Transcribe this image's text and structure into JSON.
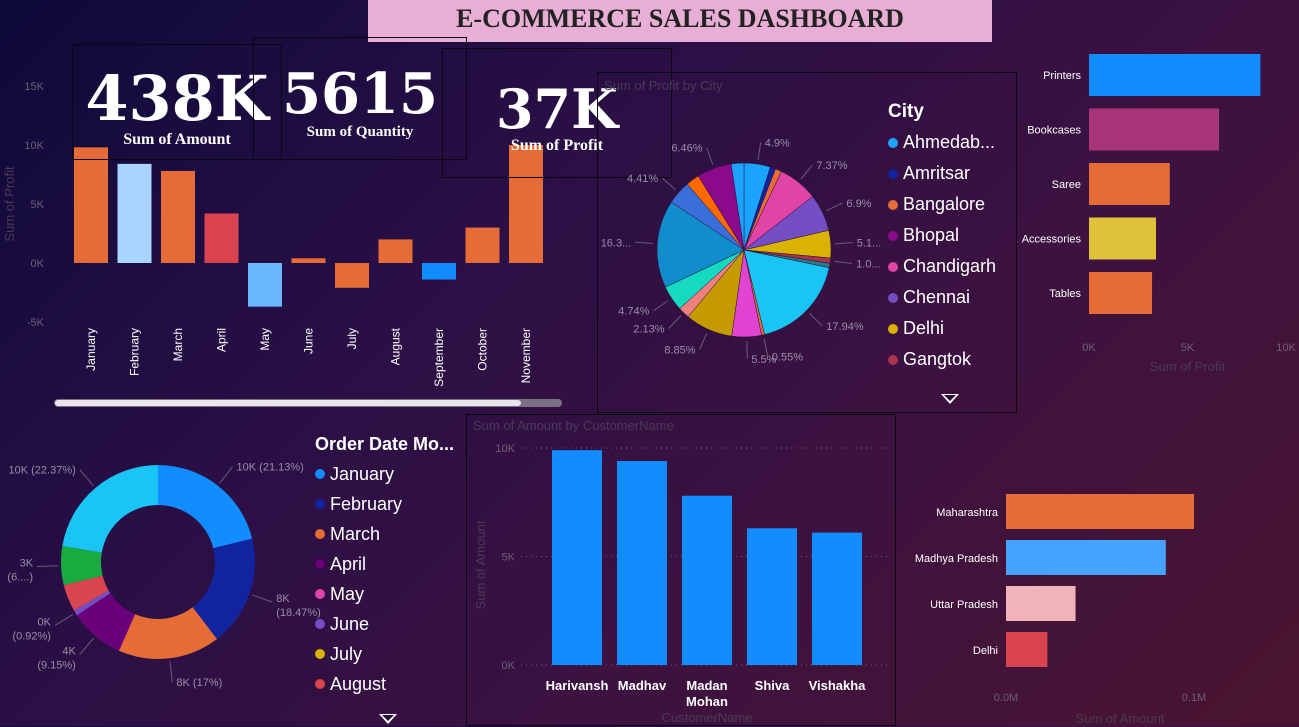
{
  "header": {
    "title": "E-COMMERCE SALES DASHBOARD"
  },
  "kpis": [
    {
      "value": "438K",
      "label": "Sum of Amount"
    },
    {
      "value": "5615",
      "label": "Sum of Quantity"
    },
    {
      "value": "37K",
      "label": "Sum of Profit"
    }
  ],
  "colors": {
    "title_bg": "#e8aed6",
    "blue": "#118dff",
    "orange": "#e66c37"
  },
  "chart_data": [
    {
      "id": "profit_by_month",
      "type": "bar",
      "ylabel": "Sum of Profit",
      "ylim": [
        -5000,
        15000
      ],
      "yticks": [
        "15K",
        "10K",
        "5K",
        "0K",
        "-5K"
      ],
      "categories": [
        "January",
        "February",
        "March",
        "April",
        "May",
        "June",
        "July",
        "August",
        "September",
        "October",
        "November"
      ],
      "values": [
        9800,
        8400,
        7800,
        4200,
        -3700,
        400,
        -2100,
        2000,
        -1400,
        3000,
        10000
      ],
      "colors": [
        "#e66c37",
        "#a8d4ff",
        "#e66c37",
        "#d9434f",
        "#6cb8ff",
        "#e66c37",
        "#e66c37",
        "#e66c37",
        "#118dff",
        "#e66c37",
        "#e66c37"
      ]
    },
    {
      "id": "profit_by_city",
      "type": "pie",
      "title": "Sum of Profit by City",
      "legend_title": "City",
      "legend": [
        {
          "name": "Ahmedab...",
          "color": "#1aa3ff"
        },
        {
          "name": "Amritsar",
          "color": "#12239e"
        },
        {
          "name": "Bangalore",
          "color": "#e66c37"
        },
        {
          "name": "Bhopal",
          "color": "#8b0a8b"
        },
        {
          "name": "Chandigarh",
          "color": "#e044a7"
        },
        {
          "name": "Chennai",
          "color": "#744ec2"
        },
        {
          "name": "Delhi",
          "color": "#d9b300"
        },
        {
          "name": "Gangtok",
          "color": "#a8344b"
        }
      ],
      "slices": [
        {
          "pct": 4.9,
          "label": "4.9%",
          "color": "#1aa3ff"
        },
        {
          "pct": 1.0,
          "label": "",
          "color": "#12239e"
        },
        {
          "pct": 1.2,
          "label": "",
          "color": "#e66c37"
        },
        {
          "pct": 7.37,
          "label": "7.37%",
          "color": "#e044a7"
        },
        {
          "pct": 6.9,
          "label": "6.9%",
          "color": "#744ec2"
        },
        {
          "pct": 5.1,
          "label": "5.1...",
          "color": "#d9b300"
        },
        {
          "pct": 1.0,
          "label": "1.0...",
          "color": "#a8344b"
        },
        {
          "pct": 0.8,
          "label": "",
          "color": "#2a7a8a"
        },
        {
          "pct": 17.94,
          "label": "17.94%",
          "color": "#1ac5f5"
        },
        {
          "pct": 0.55,
          "label": "0.55%",
          "color": "#e66c37"
        },
        {
          "pct": 5.5,
          "label": "5.5%",
          "color": "#e044d0"
        },
        {
          "pct": 8.85,
          "label": "8.85%",
          "color": "#c49a00"
        },
        {
          "pct": 2.13,
          "label": "2.13%",
          "color": "#f08080"
        },
        {
          "pct": 4.74,
          "label": "4.74%",
          "color": "#15d9c0"
        },
        {
          "pct": 16.3,
          "label": "16.3...",
          "color": "#118dcc"
        },
        {
          "pct": 4.41,
          "label": "4.41%",
          "color": "#3a6fd9"
        },
        {
          "pct": 2.5,
          "label": "",
          "color": "#ff6a00"
        },
        {
          "pct": 6.46,
          "label": "6.46%",
          "color": "#8b0a8b"
        },
        {
          "pct": 2.35,
          "label": "",
          "color": "#1aa3ff"
        }
      ]
    },
    {
      "id": "profit_by_subcategory",
      "type": "bar",
      "orientation": "horizontal",
      "xlabel": "Sum of Profit",
      "xlim": [
        0,
        10000
      ],
      "xticks": [
        "0K",
        "5K",
        "10K"
      ],
      "categories": [
        "Printers",
        "Bookcases",
        "Saree",
        "Accessories",
        "Tables"
      ],
      "values": [
        8700,
        6600,
        4100,
        3400,
        3200
      ],
      "colors": [
        "#118dff",
        "#a8347a",
        "#e66c37",
        "#e0c13a",
        "#e66c37"
      ]
    },
    {
      "id": "amount_by_month",
      "type": "pie",
      "donut": true,
      "legend_title": "Order Date Mo...",
      "legend": [
        {
          "name": "January",
          "color": "#118dff"
        },
        {
          "name": "February",
          "color": "#12239e"
        },
        {
          "name": "March",
          "color": "#e66c37"
        },
        {
          "name": "April",
          "color": "#6b007b"
        },
        {
          "name": "May",
          "color": "#e044a7"
        },
        {
          "name": "June",
          "color": "#744ec2"
        },
        {
          "name": "July",
          "color": "#d9b300"
        },
        {
          "name": "August",
          "color": "#d64550"
        }
      ],
      "slices": [
        {
          "pct": 21.13,
          "color": "#118dff"
        },
        {
          "pct": 18.47,
          "color": "#12239e"
        },
        {
          "pct": 17.0,
          "color": "#e66c37"
        },
        {
          "pct": 9.15,
          "color": "#6b007b"
        },
        {
          "pct": 0.92,
          "color": "#744ec2"
        },
        {
          "pct": 4.5,
          "color": "#d64550"
        },
        {
          "pct": 6.46,
          "color": "#1aab40"
        },
        {
          "pct": 22.37,
          "color": "#1ac5f5"
        }
      ],
      "labels": [
        {
          "l1": "10K (21.13%)",
          "l2": ""
        },
        {
          "l1": "8K",
          "l2": "(18.47%)"
        },
        {
          "l1": "8K (17%)",
          "l2": ""
        },
        {
          "l1": "4K",
          "l2": "(9.15%)"
        },
        {
          "l1": "0K",
          "l2": "(0.92%)"
        },
        {
          "l1": "3K",
          "l2": "(6....)"
        },
        {
          "l1": "10K (22.37%)",
          "l2": ""
        }
      ]
    },
    {
      "id": "amount_by_customer",
      "type": "bar",
      "title": "Sum of Amount by CustomerName",
      "ylabel": "Sum of Amount",
      "xlabel": "CustomerName",
      "ylim": [
        0,
        10000
      ],
      "yticks": [
        "10K",
        "5K",
        "0K"
      ],
      "categories": [
        "Harivansh",
        "Madhav",
        "Madan Mohan",
        "Shiva",
        "Vishakha"
      ],
      "cat_lines": [
        [
          "Harivansh"
        ],
        [
          "Madhav"
        ],
        [
          "Madan",
          "Mohan"
        ],
        [
          "Shiva"
        ],
        [
          "Vishakha"
        ]
      ],
      "values": [
        9900,
        9400,
        7800,
        6300,
        6100
      ],
      "color": "#118dff"
    },
    {
      "id": "amount_by_state",
      "type": "bar",
      "orientation": "horizontal",
      "xlabel": "Sum of Amount",
      "xticks": [
        "0.0M",
        "0.1M"
      ],
      "xlim": [
        0,
        0.1
      ],
      "categories": [
        "Maharashtra",
        "Madhya Pradesh",
        "Uttar Pradesh",
        "Delhi"
      ],
      "values": [
        0.1,
        0.085,
        0.037,
        0.022
      ],
      "colors": [
        "#e66c37",
        "#46a2ff",
        "#f0b4b8",
        "#d9434f"
      ]
    }
  ]
}
